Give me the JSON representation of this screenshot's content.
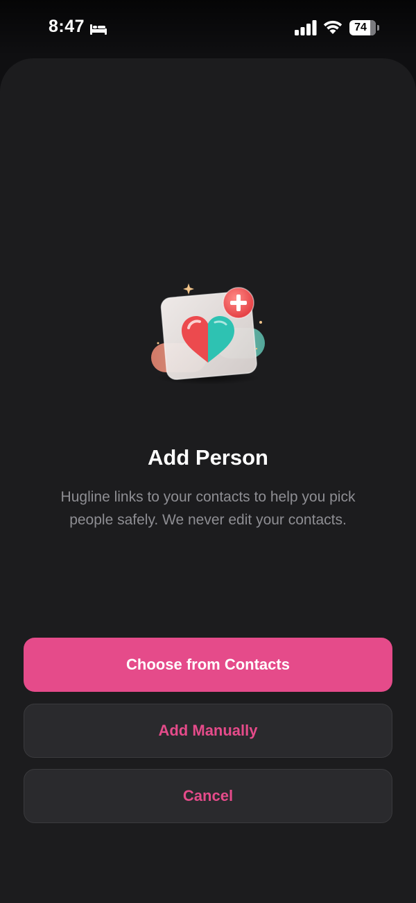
{
  "status_bar": {
    "time": "8:47",
    "battery_level": "74",
    "icons": [
      "bed-icon",
      "cellular-signal-icon",
      "wifi-icon",
      "battery-icon"
    ]
  },
  "sheet": {
    "illustration": "heart-contact-card-add-icon",
    "title": "Add Person",
    "description": "Hugline links to your contacts to help you pick people safely. We never edit your contacts."
  },
  "actions": {
    "choose_contacts_label": "Choose from Contacts",
    "add_manually_label": "Add Manually",
    "cancel_label": "Cancel"
  },
  "colors": {
    "accent": "#e54b8a",
    "sheet_background": "#1c1c1e",
    "secondary_button": "#2a2a2d",
    "description_text": "#8e8e93"
  }
}
